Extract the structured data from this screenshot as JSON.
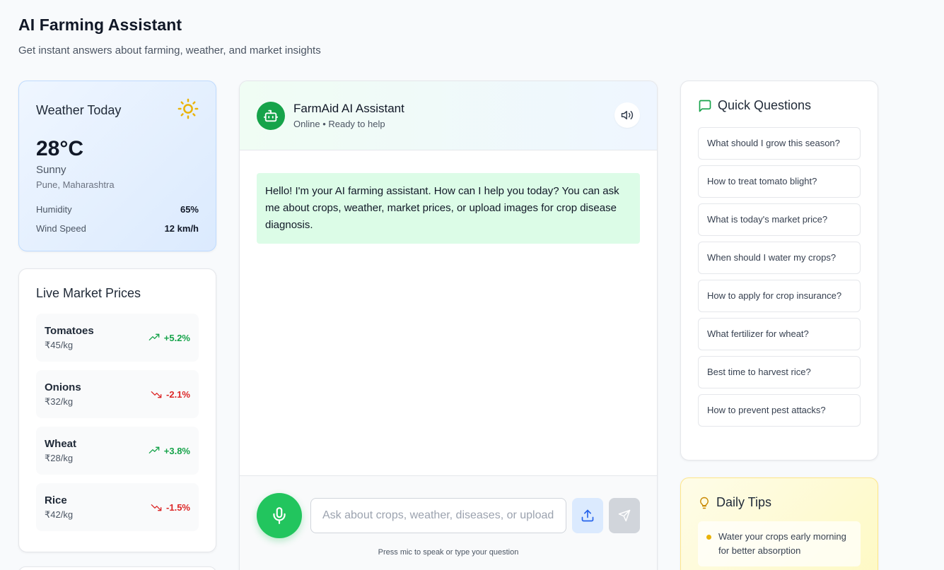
{
  "header": {
    "title": "AI Farming Assistant",
    "subtitle": "Get instant answers about farming, weather, and market insights"
  },
  "weather": {
    "title": "Weather Today",
    "icon": "sun-icon",
    "temperature": "28°C",
    "condition": "Sunny",
    "location": "Pune, Maharashtra",
    "humidity_label": "Humidity",
    "humidity_value": "65%",
    "wind_label": "Wind Speed",
    "wind_value": "12 km/h"
  },
  "market": {
    "title": "Live Market Prices",
    "items": [
      {
        "name": "Tomatoes",
        "price": "₹45/kg",
        "change": "+5.2%",
        "trend": "up"
      },
      {
        "name": "Onions",
        "price": "₹32/kg",
        "change": "-2.1%",
        "trend": "down"
      },
      {
        "name": "Wheat",
        "price": "₹28/kg",
        "change": "+3.8%",
        "trend": "up"
      },
      {
        "name": "Rice",
        "price": "₹42/kg",
        "change": "-1.5%",
        "trend": "down"
      }
    ]
  },
  "chat": {
    "bot_name": "FarmAid AI Assistant",
    "bot_status": "Online • Ready to help",
    "messages": [
      {
        "from": "bot",
        "text": "Hello! I'm your AI farming assistant. How can I help you today? You can ask me about crops, weather, market prices, or upload images for crop disease diagnosis."
      }
    ],
    "input_placeholder": "Ask about crops, weather, diseases, or upload an image...",
    "input_value": "",
    "hint": "Press mic to speak or type your question"
  },
  "quick_questions": {
    "title": "Quick Questions",
    "items": [
      "What should I grow this season?",
      "How to treat tomato blight?",
      "What is today's market price?",
      "When should I water my crops?",
      "How to apply for crop insurance?",
      "What fertilizer for wheat?",
      "Best time to harvest rice?",
      "How to prevent pest attacks?"
    ]
  },
  "tips": {
    "title": "Daily Tips",
    "items": [
      "Water your crops early morning for better absorption"
    ]
  },
  "colors": {
    "brand_green": "#16a34a",
    "up": "#16a34a",
    "down": "#dc2626",
    "bubble": "#dcfce7"
  }
}
